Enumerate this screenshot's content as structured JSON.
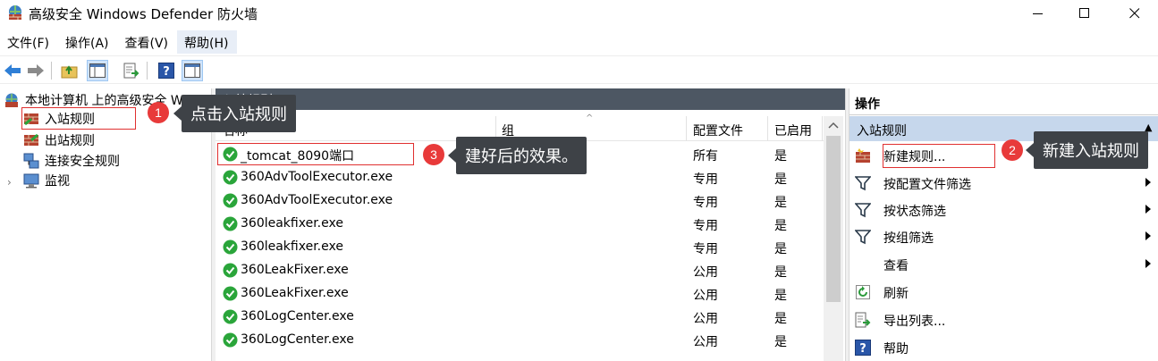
{
  "window": {
    "title": "高级安全 Windows Defender 防火墙"
  },
  "menu": [
    {
      "label": "文件(F)"
    },
    {
      "label": "操作(A)"
    },
    {
      "label": "查看(V)"
    },
    {
      "label": "帮助(H)"
    }
  ],
  "tree": {
    "root": "本地计算机 上的高级安全 Windows Defender 防火墙",
    "items": [
      {
        "label": "入站规则"
      },
      {
        "label": "出站规则"
      },
      {
        "label": "连接安全规则"
      },
      {
        "label": "监视"
      }
    ]
  },
  "center": {
    "header": "入站规则",
    "columns": {
      "name": "名称",
      "group": "组",
      "profile": "配置文件",
      "enabled": "已启用"
    },
    "rows": [
      {
        "name": "_tomcat_8090端口",
        "profile": "所有",
        "enabled": "是"
      },
      {
        "name": "360AdvToolExecutor.exe",
        "profile": "专用",
        "enabled": "是"
      },
      {
        "name": "360AdvToolExecutor.exe",
        "profile": "专用",
        "enabled": "是"
      },
      {
        "name": "360leakfixer.exe",
        "profile": "专用",
        "enabled": "是"
      },
      {
        "name": "360leakfixer.exe",
        "profile": "专用",
        "enabled": "是"
      },
      {
        "name": "360LeakFixer.exe",
        "profile": "公用",
        "enabled": "是"
      },
      {
        "name": "360LeakFixer.exe",
        "profile": "公用",
        "enabled": "是"
      },
      {
        "name": "360LogCenter.exe",
        "profile": "公用",
        "enabled": "是"
      },
      {
        "name": "360LogCenter.exe",
        "profile": "公用",
        "enabled": "是"
      }
    ]
  },
  "actions": {
    "title": "操作",
    "section": "入站规则",
    "items": [
      {
        "label": "新建规则...",
        "icon": "new-rule-icon"
      },
      {
        "label": "按配置文件筛选",
        "icon": "filter-icon"
      },
      {
        "label": "按状态筛选",
        "icon": "filter-icon"
      },
      {
        "label": "按组筛选",
        "icon": "filter-icon"
      },
      {
        "label": "查看",
        "icon": ""
      },
      {
        "label": "刷新",
        "icon": "refresh-icon"
      },
      {
        "label": "导出列表...",
        "icon": "export-icon"
      },
      {
        "label": "帮助",
        "icon": "help-icon"
      }
    ]
  },
  "annotations": [
    {
      "number": "1",
      "text": "点击入站规则"
    },
    {
      "number": "2",
      "text": "新建入站规则"
    },
    {
      "number": "3",
      "text": "建好后的效果。"
    }
  ],
  "colors": {
    "header_dark": "#4d5763",
    "actions_section": "#c6d7ec",
    "annotation_red": "#e83a3a",
    "callout_bg": "#3e4247",
    "check_green": "#2aa53a"
  }
}
